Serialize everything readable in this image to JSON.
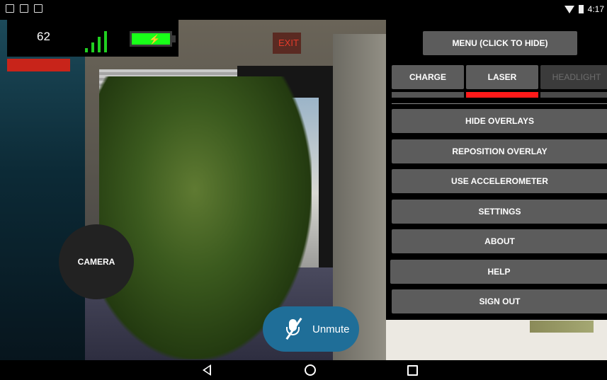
{
  "status_bar": {
    "time": "4:17",
    "left_icons": [
      "image-icon",
      "photo-icon",
      "phone-icon"
    ],
    "right_icons": [
      "wifi-icon",
      "battery-icon"
    ]
  },
  "overlay": {
    "signal_value": "62",
    "signal_color": "#20d020",
    "battery_color": "#19ff19",
    "battery_icon": "charging-bolt-icon",
    "status_strip_color": "#c8241a"
  },
  "camera_button": {
    "label": "CAMERA"
  },
  "unmute_button": {
    "label": "Unmute",
    "icon": "mic-off-icon",
    "color": "#1f6e98"
  },
  "menu": {
    "toggle_label": "MENU (CLICK TO HIDE)",
    "tabs": [
      {
        "label": "CHARGE",
        "active": false
      },
      {
        "label": "LASER",
        "active": true
      },
      {
        "label": "HEADLIGHT",
        "active": false,
        "disabled": true
      }
    ],
    "active_tab_color": "#ff1a1a",
    "items": [
      {
        "label": "HIDE OVERLAYS"
      },
      {
        "label": "REPOSITION OVERLAY"
      },
      {
        "label": "USE ACCELEROMETER"
      },
      {
        "label": "SETTINGS"
      },
      {
        "label": "ABOUT"
      },
      {
        "label": "HELP"
      },
      {
        "label": "SIGN OUT"
      }
    ]
  },
  "scene": {
    "sign_text": "EXIT"
  },
  "nav_bar": {
    "icons": [
      "back-icon",
      "home-icon",
      "recents-icon"
    ]
  }
}
